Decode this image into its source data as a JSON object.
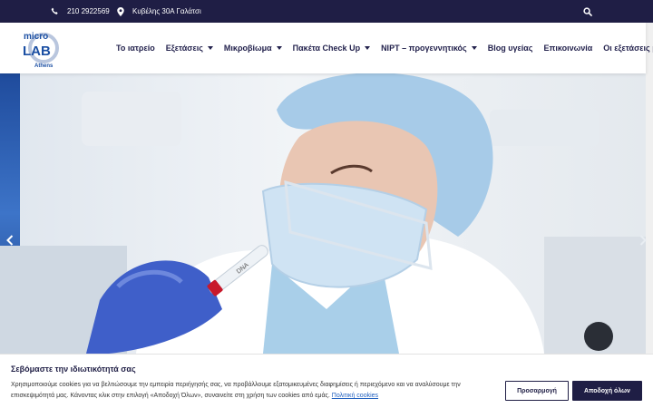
{
  "colors": {
    "topbar_bg": "#1f1e45",
    "nav_text": "#23224d",
    "brand_blue": "#1b4fa3",
    "accent": "#1f5fbf"
  },
  "topbar": {
    "phone_icon": "phone-icon",
    "phone": "210 2922569",
    "address_icon": "map-marker-icon",
    "address": "Κυβέλης 30Α Γαλάτσι",
    "search_icon": "search-icon"
  },
  "logo": {
    "line1": "micro",
    "line2": "LAB",
    "line3": "Athens"
  },
  "nav": {
    "items": [
      {
        "label": "Το ιατρείο",
        "dropdown": false
      },
      {
        "label": "Εξετάσεις",
        "dropdown": true
      },
      {
        "label": "Μικροβίωμα",
        "dropdown": true
      },
      {
        "label": "Πακέτα Check Up",
        "dropdown": true
      },
      {
        "label": "NIPT – προγεννητικός",
        "dropdown": true
      },
      {
        "label": "Blog υγείας",
        "dropdown": false
      },
      {
        "label": "Επικοινωνία",
        "dropdown": false
      },
      {
        "label": "Οι εξετάσεις μου",
        "dropdown": false
      }
    ]
  },
  "hero": {
    "tube_label": "DNA",
    "prev_icon": "chevron-left-icon",
    "next_icon": "chevron-right-icon"
  },
  "cookie": {
    "title": "Σεβόμαστε την ιδιωτικότητά σας",
    "text": "Χρησιμοποιούμε cookies για να βελτιώσουμε την εμπειρία περιήγησής σας, να προβάλλουμε εξατομικευμένες διαφημίσεις ή περιεχόμενο και να αναλύσουμε την επισκεψιμότητά μας. Κάνοντας κλικ στην επιλογή «Αποδοχή Όλων», συναινείτε στη χρήση των cookies από εμάς.",
    "link": "Πολιτική cookies",
    "customize": "Προσαρμογή",
    "accept": "Αποδοχή όλων"
  }
}
